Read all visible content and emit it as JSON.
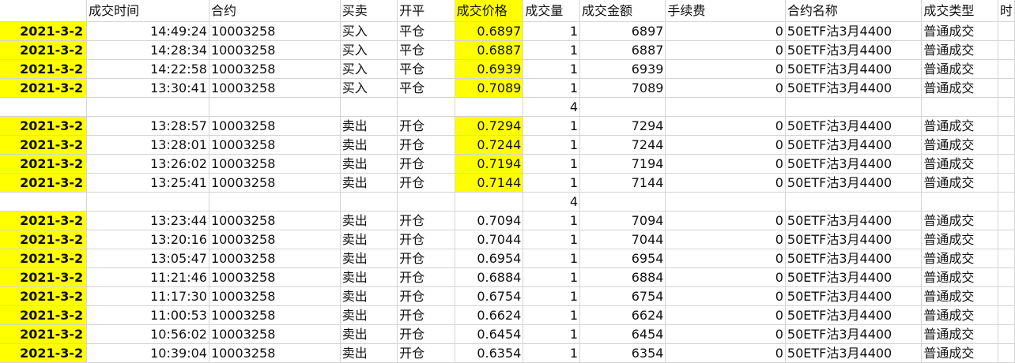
{
  "colors": {
    "highlight": "#ffff00",
    "gridline": "#d4d4d4"
  },
  "headers": [
    "",
    "成交时间",
    "合约",
    "买卖",
    "开平",
    "成交价格",
    "成交量",
    "成交金额",
    "手续费",
    "合约名称",
    "成交类型",
    "时"
  ],
  "rows": [
    {
      "type": "data",
      "date": "2021-3-2",
      "time": "14:49:24",
      "contract": "10003258",
      "side": "买入",
      "openclose": "平仓",
      "price": "0.6897",
      "qty": "1",
      "amount": "6897",
      "fee": "0",
      "name": "50ETF沽3月4400",
      "tradetype": "普通成交",
      "price_hl": true
    },
    {
      "type": "data",
      "date": "2021-3-2",
      "time": "14:28:34",
      "contract": "10003258",
      "side": "买入",
      "openclose": "平仓",
      "price": "0.6887",
      "qty": "1",
      "amount": "6887",
      "fee": "0",
      "name": "50ETF沽3月4400",
      "tradetype": "普通成交",
      "price_hl": true
    },
    {
      "type": "data",
      "date": "2021-3-2",
      "time": "14:22:58",
      "contract": "10003258",
      "side": "买入",
      "openclose": "平仓",
      "price": "0.6939",
      "qty": "1",
      "amount": "6939",
      "fee": "0",
      "name": "50ETF沽3月4400",
      "tradetype": "普通成交",
      "price_hl": true
    },
    {
      "type": "data",
      "date": "2021-3-2",
      "time": "13:30:41",
      "contract": "10003258",
      "side": "买入",
      "openclose": "平仓",
      "price": "0.7089",
      "qty": "1",
      "amount": "7089",
      "fee": "0",
      "name": "50ETF沽3月4400",
      "tradetype": "普通成交",
      "price_hl": true
    },
    {
      "type": "sum",
      "qty": "4"
    },
    {
      "type": "data",
      "date": "2021-3-2",
      "time": "13:28:57",
      "contract": "10003258",
      "side": "卖出",
      "openclose": "开仓",
      "price": "0.7294",
      "qty": "1",
      "amount": "7294",
      "fee": "0",
      "name": "50ETF沽3月4400",
      "tradetype": "普通成交",
      "price_hl": true
    },
    {
      "type": "data",
      "date": "2021-3-2",
      "time": "13:28:01",
      "contract": "10003258",
      "side": "卖出",
      "openclose": "开仓",
      "price": "0.7244",
      "qty": "1",
      "amount": "7244",
      "fee": "0",
      "name": "50ETF沽3月4400",
      "tradetype": "普通成交",
      "price_hl": true
    },
    {
      "type": "data",
      "date": "2021-3-2",
      "time": "13:26:02",
      "contract": "10003258",
      "side": "卖出",
      "openclose": "开仓",
      "price": "0.7194",
      "qty": "1",
      "amount": "7194",
      "fee": "0",
      "name": "50ETF沽3月4400",
      "tradetype": "普通成交",
      "price_hl": true
    },
    {
      "type": "data",
      "date": "2021-3-2",
      "time": "13:25:41",
      "contract": "10003258",
      "side": "卖出",
      "openclose": "开仓",
      "price": "0.7144",
      "qty": "1",
      "amount": "7144",
      "fee": "0",
      "name": "50ETF沽3月4400",
      "tradetype": "普通成交",
      "price_hl": true
    },
    {
      "type": "sum",
      "qty": "4"
    },
    {
      "type": "data",
      "date": "2021-3-2",
      "time": "13:23:44",
      "contract": "10003258",
      "side": "卖出",
      "openclose": "开仓",
      "price": "0.7094",
      "qty": "1",
      "amount": "7094",
      "fee": "0",
      "name": "50ETF沽3月4400",
      "tradetype": "普通成交",
      "price_hl": false
    },
    {
      "type": "data",
      "date": "2021-3-2",
      "time": "13:20:16",
      "contract": "10003258",
      "side": "卖出",
      "openclose": "开仓",
      "price": "0.7044",
      "qty": "1",
      "amount": "7044",
      "fee": "0",
      "name": "50ETF沽3月4400",
      "tradetype": "普通成交",
      "price_hl": false
    },
    {
      "type": "data",
      "date": "2021-3-2",
      "time": "13:05:47",
      "contract": "10003258",
      "side": "卖出",
      "openclose": "开仓",
      "price": "0.6954",
      "qty": "1",
      "amount": "6954",
      "fee": "0",
      "name": "50ETF沽3月4400",
      "tradetype": "普通成交",
      "price_hl": false
    },
    {
      "type": "data",
      "date": "2021-3-2",
      "time": "11:21:46",
      "contract": "10003258",
      "side": "卖出",
      "openclose": "开仓",
      "price": "0.6884",
      "qty": "1",
      "amount": "6884",
      "fee": "0",
      "name": "50ETF沽3月4400",
      "tradetype": "普通成交",
      "price_hl": false
    },
    {
      "type": "data",
      "date": "2021-3-2",
      "time": "11:17:30",
      "contract": "10003258",
      "side": "卖出",
      "openclose": "开仓",
      "price": "0.6754",
      "qty": "1",
      "amount": "6754",
      "fee": "0",
      "name": "50ETF沽3月4400",
      "tradetype": "普通成交",
      "price_hl": false
    },
    {
      "type": "data",
      "date": "2021-3-2",
      "time": "11:00:53",
      "contract": "10003258",
      "side": "卖出",
      "openclose": "开仓",
      "price": "0.6624",
      "qty": "1",
      "amount": "6624",
      "fee": "0",
      "name": "50ETF沽3月4400",
      "tradetype": "普通成交",
      "price_hl": false
    },
    {
      "type": "data",
      "date": "2021-3-2",
      "time": "10:56:02",
      "contract": "10003258",
      "side": "卖出",
      "openclose": "开仓",
      "price": "0.6454",
      "qty": "1",
      "amount": "6454",
      "fee": "0",
      "name": "50ETF沽3月4400",
      "tradetype": "普通成交",
      "price_hl": false
    },
    {
      "type": "data",
      "date": "2021-3-2",
      "time": "10:39:04",
      "contract": "10003258",
      "side": "卖出",
      "openclose": "开仓",
      "price": "0.6354",
      "qty": "1",
      "amount": "6354",
      "fee": "0",
      "name": "50ETF沽3月4400",
      "tradetype": "普通成交",
      "price_hl": false
    }
  ]
}
